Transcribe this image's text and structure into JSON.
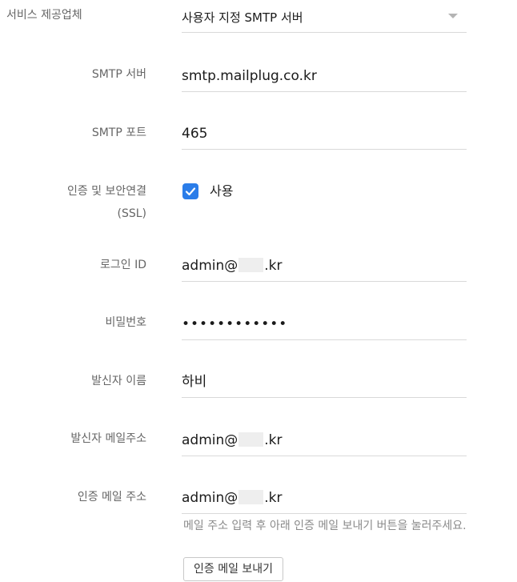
{
  "form": {
    "provider": {
      "label": "서비스 제공업체",
      "value": "사용자 지정 SMTP 서버"
    },
    "smtp_server": {
      "label": "SMTP 서버",
      "value": "smtp.mailplug.co.kr"
    },
    "smtp_port": {
      "label": "SMTP 포트",
      "value": "465"
    },
    "ssl": {
      "label_line1": "인증 및 보안연결",
      "label_line2": "(SSL)",
      "checkbox_label": "사용",
      "checked": true
    },
    "login_id": {
      "label": "로그인 ID",
      "value_prefix": "admin@",
      "value_suffix": ".kr"
    },
    "password": {
      "label": "비밀번호",
      "value": "••••••••••••"
    },
    "sender_name": {
      "label": "발신자 이름",
      "value": "하비"
    },
    "sender_email": {
      "label": "발신자 메일주소",
      "value_prefix": "admin@",
      "value_suffix": ".kr"
    },
    "auth_email": {
      "label": "인증 메일 주소",
      "value_prefix": "admin@",
      "value_suffix": ".kr",
      "helper": "메일 주소 입력 후 아래 인증 메일 보내기 버튼을 눌러주세요."
    },
    "send_button": "인증 메일 보내기"
  },
  "colors": {
    "accent": "#2b7de9",
    "label": "#666666",
    "underline": "#d9d9d9"
  },
  "icons": {
    "dropdown": "chevron-down-icon",
    "checkbox": "check-icon"
  }
}
